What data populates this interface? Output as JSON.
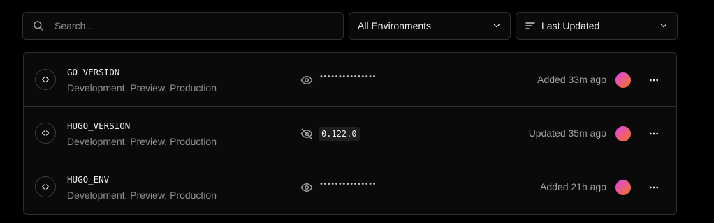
{
  "search": {
    "placeholder": "Search..."
  },
  "filters": {
    "environment_label": "All Environments",
    "sort_label": "Last Updated"
  },
  "variables": [
    {
      "name": "GO_VERSION",
      "environments": "Development, Preview, Production",
      "visibility": "hidden",
      "masked_value": "•••••••••••••••",
      "updated": "Added 33m ago"
    },
    {
      "name": "HUGO_VERSION",
      "environments": "Development, Preview, Production",
      "visibility": "shown",
      "value": "0.122.0",
      "updated": "Updated 35m ago"
    },
    {
      "name": "HUGO_ENV",
      "environments": "Development, Preview, Production",
      "visibility": "hidden",
      "masked_value": "•••••••••••••••",
      "updated": "Added 21h ago"
    }
  ],
  "icons": {
    "search": "search-icon",
    "dropdown": "chevron-down-icon",
    "sort": "sort-lines-icon",
    "variable": "code-brackets-icon",
    "show": "eye-icon",
    "hide": "eye-off-icon",
    "more": "more-horizontal-icon"
  },
  "colors": {
    "background": "#000000",
    "panel": "#0a0a0a",
    "border": "#2e2e2e",
    "avatar_from": "#d946ef",
    "avatar_to": "#f97316"
  }
}
